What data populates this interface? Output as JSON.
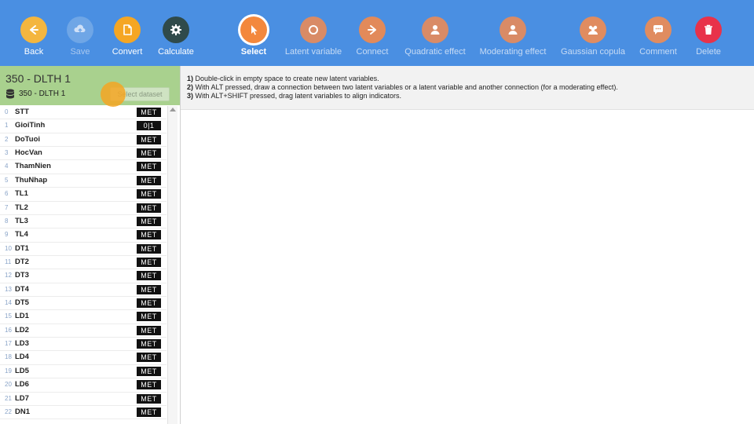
{
  "toolbar": {
    "buttons": [
      {
        "id": "back",
        "label": "Back",
        "icon": "arrow-left-icon",
        "color": "#f4b63f"
      },
      {
        "id": "save",
        "label": "Save",
        "icon": "cloud-upload-icon",
        "color": "#6fa6e6"
      },
      {
        "id": "convert",
        "label": "Convert",
        "icon": "document-icon",
        "color": "#f5a623"
      },
      {
        "id": "calculate",
        "label": "Calculate",
        "icon": "gear-icon",
        "color": "#2f4a4a"
      },
      {
        "id": "select",
        "label": "Select",
        "icon": "pointer-icon",
        "color": "#f3883d"
      },
      {
        "id": "latent",
        "label": "Latent variable",
        "icon": "circle-icon",
        "color": "#d98b66"
      },
      {
        "id": "connect",
        "label": "Connect",
        "icon": "arrow-right-icon",
        "color": "#e28a5a"
      },
      {
        "id": "quadratic",
        "label": "Quadratic effect",
        "icon": "person-icon",
        "color": "#d98b66"
      },
      {
        "id": "moderating",
        "label": "Moderating effect",
        "icon": "person-icon",
        "color": "#d98b66"
      },
      {
        "id": "gaussian",
        "label": "Gaussian copula",
        "icon": "group-icon",
        "color": "#e08c60"
      },
      {
        "id": "comment",
        "label": "Comment",
        "icon": "speech-bubble-icon",
        "color": "#e08c60"
      },
      {
        "id": "delete",
        "label": "Delete",
        "icon": "trash-icon",
        "color": "#e8324a"
      }
    ]
  },
  "sidebar": {
    "dataset_title": "350 - DLTH 1",
    "dataset_name": "350 - DLTH 1",
    "select_dataset_label": "Select dataset",
    "variables": [
      {
        "idx": "0",
        "name": "STT",
        "type": "MET"
      },
      {
        "idx": "1",
        "name": "GioiTinh",
        "type": "0|1"
      },
      {
        "idx": "2",
        "name": "DoTuoi",
        "type": "MET"
      },
      {
        "idx": "3",
        "name": "HocVan",
        "type": "MET"
      },
      {
        "idx": "4",
        "name": "ThamNien",
        "type": "MET"
      },
      {
        "idx": "5",
        "name": "ThuNhap",
        "type": "MET"
      },
      {
        "idx": "6",
        "name": "TL1",
        "type": "MET"
      },
      {
        "idx": "7",
        "name": "TL2",
        "type": "MET"
      },
      {
        "idx": "8",
        "name": "TL3",
        "type": "MET"
      },
      {
        "idx": "9",
        "name": "TL4",
        "type": "MET"
      },
      {
        "idx": "10",
        "name": "DT1",
        "type": "MET"
      },
      {
        "idx": "11",
        "name": "DT2",
        "type": "MET"
      },
      {
        "idx": "12",
        "name": "DT3",
        "type": "MET"
      },
      {
        "idx": "13",
        "name": "DT4",
        "type": "MET"
      },
      {
        "idx": "14",
        "name": "DT5",
        "type": "MET"
      },
      {
        "idx": "15",
        "name": "LD1",
        "type": "MET"
      },
      {
        "idx": "16",
        "name": "LD2",
        "type": "MET"
      },
      {
        "idx": "17",
        "name": "LD3",
        "type": "MET"
      },
      {
        "idx": "18",
        "name": "LD4",
        "type": "MET"
      },
      {
        "idx": "19",
        "name": "LD5",
        "type": "MET"
      },
      {
        "idx": "20",
        "name": "LD6",
        "type": "MET"
      },
      {
        "idx": "21",
        "name": "LD7",
        "type": "MET"
      },
      {
        "idx": "22",
        "name": "DN1",
        "type": "MET"
      }
    ]
  },
  "instructions": [
    {
      "num": "1)",
      "text": " Double-click in empty space to create new latent variables."
    },
    {
      "num": "2)",
      "text": " With ALT pressed, draw a connection between two latent variables or a latent variable and another connection (for a moderating effect)."
    },
    {
      "num": "3)",
      "text": " With ALT+SHIFT pressed, drag latent variables to align indicators."
    }
  ]
}
